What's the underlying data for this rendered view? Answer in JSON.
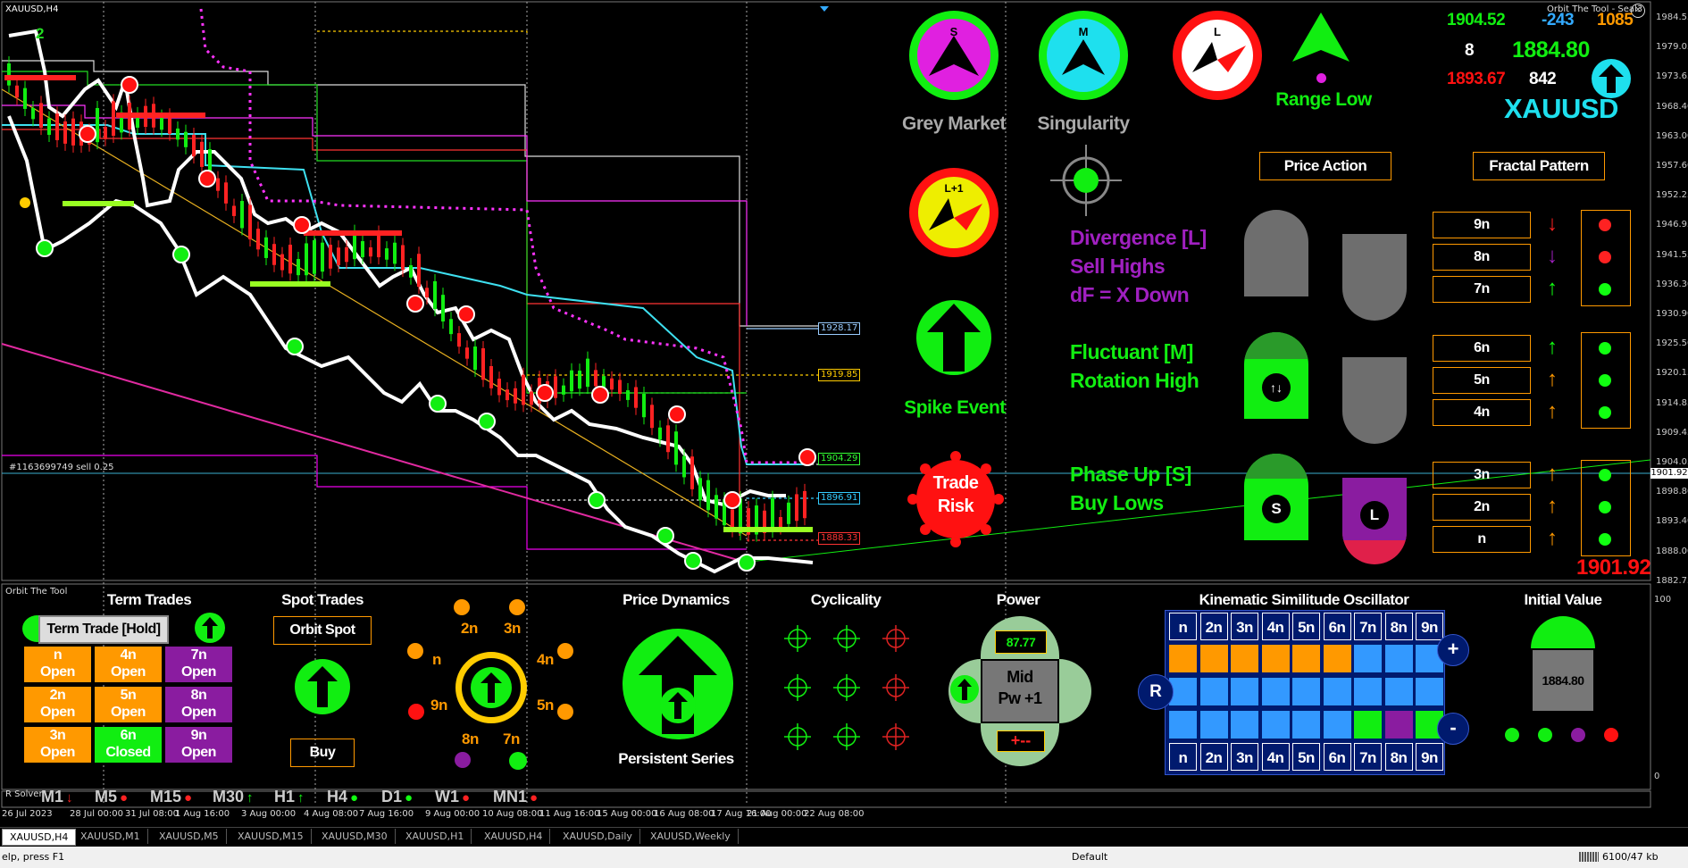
{
  "chart": {
    "symbol_title": "XAUUSD,H4",
    "indicator_label": "Orbit The Tool - Seal3",
    "order_line_label": "#1163699749 sell 0.25",
    "wave_label": "2",
    "price_axis": [
      "1984.55",
      "1979.05",
      "1973.65",
      "1968.40",
      "1963.00",
      "1957.60",
      "1952.25",
      "1946.95",
      "1941.55",
      "1936.30",
      "1930.90",
      "1925.50",
      "1920.15",
      "1914.85",
      "1909.45",
      "1904.05",
      "1898.80",
      "1893.40",
      "1888.00",
      "1882.75"
    ],
    "current_price_tag": "1901.92",
    "level_tags": [
      {
        "text": "1928.17",
        "color": "#9cf"
      },
      {
        "text": "1919.85",
        "color": "#fc0"
      },
      {
        "text": "1904.29",
        "color": "#3f3"
      },
      {
        "text": "1896.91",
        "color": "#3cf"
      },
      {
        "text": "1888.33",
        "color": "#f33"
      }
    ],
    "osc_axis": [
      "100",
      "0"
    ],
    "time_axis": [
      "26 Jul 2023",
      "28 Jul 00:00",
      "31 Jul 08:00",
      "1 Aug 16:00",
      "3 Aug 00:00",
      "4 Aug 08:00",
      "7 Aug 16:00",
      "9 Aug 00:00",
      "10 Aug 08:00",
      "11 Aug 16:00",
      "15 Aug 00:00",
      "16 Aug 08:00",
      "17 Aug 16:00",
      "21 Aug 00:00",
      "22 Aug 08:00"
    ]
  },
  "top_panel": {
    "grey_market": {
      "letter": "S",
      "label": "Grey Market"
    },
    "singularity": {
      "letter": "M",
      "label": "Singularity"
    },
    "l_compass": {
      "letter": "L"
    },
    "range_low": {
      "label": "Range Low"
    },
    "lp1": {
      "letter": "L+1"
    },
    "spike_event": {
      "label": "Spike Event"
    },
    "trade_risk": {
      "line1": "Trade",
      "line2": "Risk"
    },
    "stats": {
      "v1": "1904.52",
      "v2": "-243",
      "v3": "1085",
      "v4": "8",
      "v5": "1884.80",
      "v6": "1893.67",
      "v7": "842",
      "symbol": "XAUUSD"
    },
    "price_action": "Price Action",
    "fractal_pattern": "Fractal Pattern",
    "divergence": [
      "Divergence [L]",
      "Sell Highs",
      "dF = X Down"
    ],
    "fluctuant": [
      "Fluctuant [M]",
      "Rotation High"
    ],
    "phase_up": [
      "Phase Up [S]",
      "Buy Lows"
    ],
    "s_letter": "S",
    "l_letter": "L",
    "fractals": [
      {
        "label": "9n",
        "arrow": "↓",
        "arrow_color": "#f22",
        "dot": "#f22"
      },
      {
        "label": "8n",
        "arrow": "↓",
        "arrow_color": "#a020c0",
        "dot": "#f22"
      },
      {
        "label": "7n",
        "arrow": "↑",
        "arrow_color": "#1f1",
        "dot": "#1f1"
      },
      {
        "label": "6n",
        "arrow": "↑",
        "arrow_color": "#1f1",
        "dot": "#1f1"
      },
      {
        "label": "5n",
        "arrow": "↑",
        "arrow_color": "#f90",
        "dot": "#1f1"
      },
      {
        "label": "4n",
        "arrow": "↑",
        "arrow_color": "#f90",
        "dot": "#1f1"
      },
      {
        "label": "3n",
        "arrow": "↑",
        "arrow_color": "#f90",
        "dot": "#1f1"
      },
      {
        "label": "2n",
        "arrow": "↑",
        "arrow_color": "#f90",
        "dot": "#1f1"
      },
      {
        "label": "n",
        "arrow": "↑",
        "arrow_color": "#f90",
        "dot": "#1f1"
      }
    ],
    "big_price": "1901.92"
  },
  "bottom_panel": {
    "title": "Orbit The Tool",
    "term_trades": {
      "title": "Term Trades",
      "button": "Term Trade [Hold]",
      "cells": [
        {
          "l1": "n",
          "l2": "Open",
          "color": "#f90"
        },
        {
          "l1": "4n",
          "l2": "Open",
          "color": "#f90"
        },
        {
          "l1": "7n",
          "l2": "Open",
          "color": "#8a1ca0"
        },
        {
          "l1": "2n",
          "l2": "Open",
          "color": "#f90"
        },
        {
          "l1": "5n",
          "l2": "Open",
          "color": "#f90"
        },
        {
          "l1": "8n",
          "l2": "Open",
          "color": "#8a1ca0"
        },
        {
          "l1": "3n",
          "l2": "Open",
          "color": "#f90"
        },
        {
          "l1": "6n",
          "l2": "Closed",
          "color": "#1e1"
        },
        {
          "l1": "9n",
          "l2": "Open",
          "color": "#8a1ca0"
        }
      ]
    },
    "spot_trades": {
      "title": "Spot Trades",
      "button": "Orbit Spot",
      "buy": "Buy"
    },
    "orbit_labels": {
      "n2": "2n",
      "n3": "3n",
      "n": "n",
      "n4": "4n",
      "n9": "9n",
      "n5": "5n",
      "n8": "8n",
      "n7": "7n"
    },
    "price_dynamics": {
      "title": "Price Dynamics",
      "subtitle": "Persistent Series"
    },
    "cyclicality": {
      "title": "Cyclicality"
    },
    "power": {
      "title": "Power",
      "value": "87.77",
      "mid1": "Mid",
      "mid2": "Pw +1",
      "plusminus": "+--"
    },
    "kso": {
      "title": "Kinematic Similitude Oscillator",
      "headers": [
        "n",
        "2n",
        "3n",
        "4n",
        "5n",
        "6n",
        "7n",
        "8n",
        "9n"
      ],
      "rows": [
        [
          "#f90",
          "#f90",
          "#f90",
          "#f90",
          "#f90",
          "#f90",
          "#3399ff",
          "#3399ff",
          "#3399ff"
        ],
        [
          "#3399ff",
          "#3399ff",
          "#3399ff",
          "#3399ff",
          "#3399ff",
          "#3399ff",
          "#3399ff",
          "#3399ff",
          "#3399ff"
        ],
        [
          "#3399ff",
          "#3399ff",
          "#3399ff",
          "#3399ff",
          "#3399ff",
          "#3399ff",
          "#1e1",
          "#8a1ca0",
          "#1e1"
        ]
      ],
      "r": "R",
      "plus": "+",
      "minus": "-"
    },
    "initial_value": {
      "title": "Initial Value",
      "value": "1884.80"
    }
  },
  "solver": {
    "label": "R Solver",
    "timeframes": [
      {
        "tf": "M1",
        "mark": "↓",
        "color": "#f22"
      },
      {
        "tf": "M5",
        "mark": "●",
        "color": "#f22"
      },
      {
        "tf": "M15",
        "mark": "●",
        "color": "#f22"
      },
      {
        "tf": "M30",
        "mark": "↑",
        "color": "#1f1"
      },
      {
        "tf": "H1",
        "mark": "↑",
        "color": "#1f1"
      },
      {
        "tf": "H4",
        "mark": "●",
        "color": "#1f1"
      },
      {
        "tf": "D1",
        "mark": "●",
        "color": "#1f1"
      },
      {
        "tf": "W1",
        "mark": "●",
        "color": "#f22"
      },
      {
        "tf": "MN1",
        "mark": "●",
        "color": "#f22"
      }
    ]
  },
  "tabs": [
    "XAUUSD,H4",
    "XAUUSD,M1",
    "XAUUSD,M5",
    "XAUUSD,M15",
    "XAUUSD,M30",
    "XAUUSD,H1",
    "XAUUSD,H4",
    "XAUUSD,Daily",
    "XAUUSD,Weekly"
  ],
  "status": {
    "help": "elp, press F1",
    "profile": "Default",
    "traffic": "6100/47 kb"
  }
}
